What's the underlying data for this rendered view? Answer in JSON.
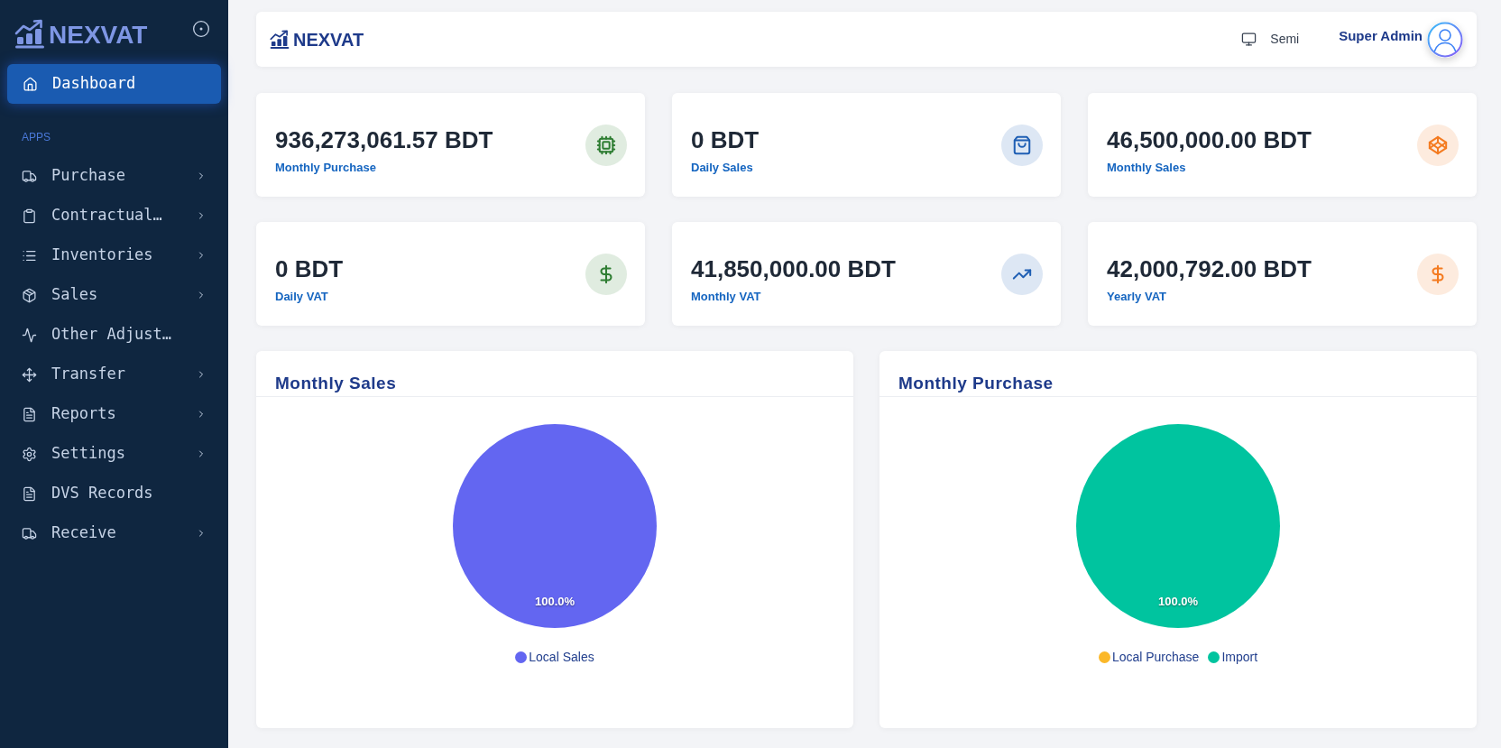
{
  "sidebar": {
    "logo": "NEXVAT",
    "items": [
      {
        "label": "Dashboard",
        "selected": true,
        "submenu": false
      }
    ],
    "section": {
      "label": "APPS",
      "items": [
        {
          "label": "Purchase",
          "selected": false,
          "submenu": true
        },
        {
          "label": "Contractual…",
          "selected": false,
          "submenu": true
        },
        {
          "label": "Inventories",
          "selected": false,
          "submenu": true
        },
        {
          "label": "Sales",
          "selected": false,
          "submenu": true
        },
        {
          "label": "Other Adjust…",
          "selected": false,
          "submenu": false
        },
        {
          "label": "Transfer",
          "selected": false,
          "submenu": true
        },
        {
          "label": "Reports",
          "selected": false,
          "submenu": true
        },
        {
          "label": "Settings",
          "selected": false,
          "submenu": true
        },
        {
          "label": "DVS Records",
          "selected": false,
          "submenu": false
        },
        {
          "label": "Receive",
          "selected": false,
          "submenu": true
        }
      ]
    }
  },
  "header": {
    "logo": "NEXVAT",
    "theme": "Semi",
    "user": "Super Admin"
  },
  "stats": [
    {
      "value": "936,273,061.57 BDT",
      "label": "Monthly Purchase",
      "color": "#2e7d32"
    },
    {
      "value": "0 BDT",
      "label": "Daily Sales",
      "color": "#1f5fb4"
    },
    {
      "value": "46,500,000.00 BDT",
      "label": "Monthly Sales",
      "color": "#f47b20"
    },
    {
      "value": "0 BDT",
      "label": "Daily VAT",
      "color": "#2e7d32"
    },
    {
      "value": "41,850,000.00 BDT",
      "label": "Monthly VAT",
      "color": "#1f5fb4"
    },
    {
      "value": "42,000,792.00 BDT",
      "label": "Yearly VAT",
      "color": "#f47b20"
    }
  ],
  "charts": [
    {
      "chart_data": {
        "type": "pie",
        "title": "Monthly Sales",
        "categories": [
          "Local Sales"
        ],
        "values": [
          100
        ],
        "colors": [
          "#6366f1"
        ],
        "value_labels": [
          "100.0%"
        ]
      }
    },
    {
      "chart_data": {
        "type": "pie",
        "title": "Monthly Purchase",
        "categories": [
          "Local Purchase",
          "Import"
        ],
        "values": [
          0,
          100
        ],
        "colors": [
          "#fbb829",
          "#00c49f"
        ],
        "value_labels": [
          null,
          "100.0%"
        ]
      }
    }
  ]
}
